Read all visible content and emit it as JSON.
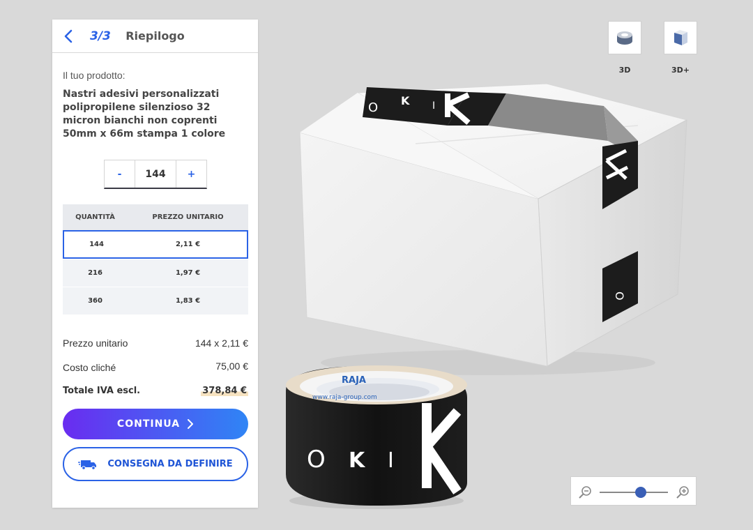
{
  "panel": {
    "step": "3/3",
    "title": "Riepilogo",
    "product_label": "Il tuo prodotto:",
    "product_name": "Nastri adesivi personalizzati polipropilene silenzioso 32 micron bianchi non coprenti 50mm x 66m stampa 1 colore",
    "quantity": {
      "minus_label": "-",
      "value": "144",
      "plus_label": "+"
    },
    "price_table": {
      "headers": [
        "QUANTITÀ",
        "PREZZO UNITARIO"
      ],
      "rows": [
        {
          "qty": "144",
          "price": "2,11 €",
          "selected": true
        },
        {
          "qty": "216",
          "price": "1,97 €",
          "selected": false
        },
        {
          "qty": "360",
          "price": "1,83 €",
          "selected": false
        }
      ]
    },
    "summary": {
      "unit_label": "Prezzo unitario",
      "unit_value": "144 x 2,11 €",
      "cliche_label": "Costo cliché",
      "cliche_value": "75,00 €",
      "total_label": "Totale IVA escl.",
      "total_value": "378,84 €"
    },
    "continue_label": "CONTINUA",
    "delivery_label": "CONSEGNA DA DEFINIRE"
  },
  "views": [
    {
      "label": "3D",
      "icon": "tape-roll-icon"
    },
    {
      "label": "3D+",
      "icon": "box-icon"
    }
  ],
  "zoom": {
    "level": 0.6
  },
  "product": {
    "tape_brand": "RAJA",
    "tape_url": "www.raja-group.com",
    "print_letters": [
      "O",
      "K",
      "I"
    ]
  },
  "colors": {
    "accent": "#2a62e6",
    "gradient_start": "#6a2cf0",
    "gradient_end": "#2f85f5",
    "print": "#1c1c1c"
  }
}
